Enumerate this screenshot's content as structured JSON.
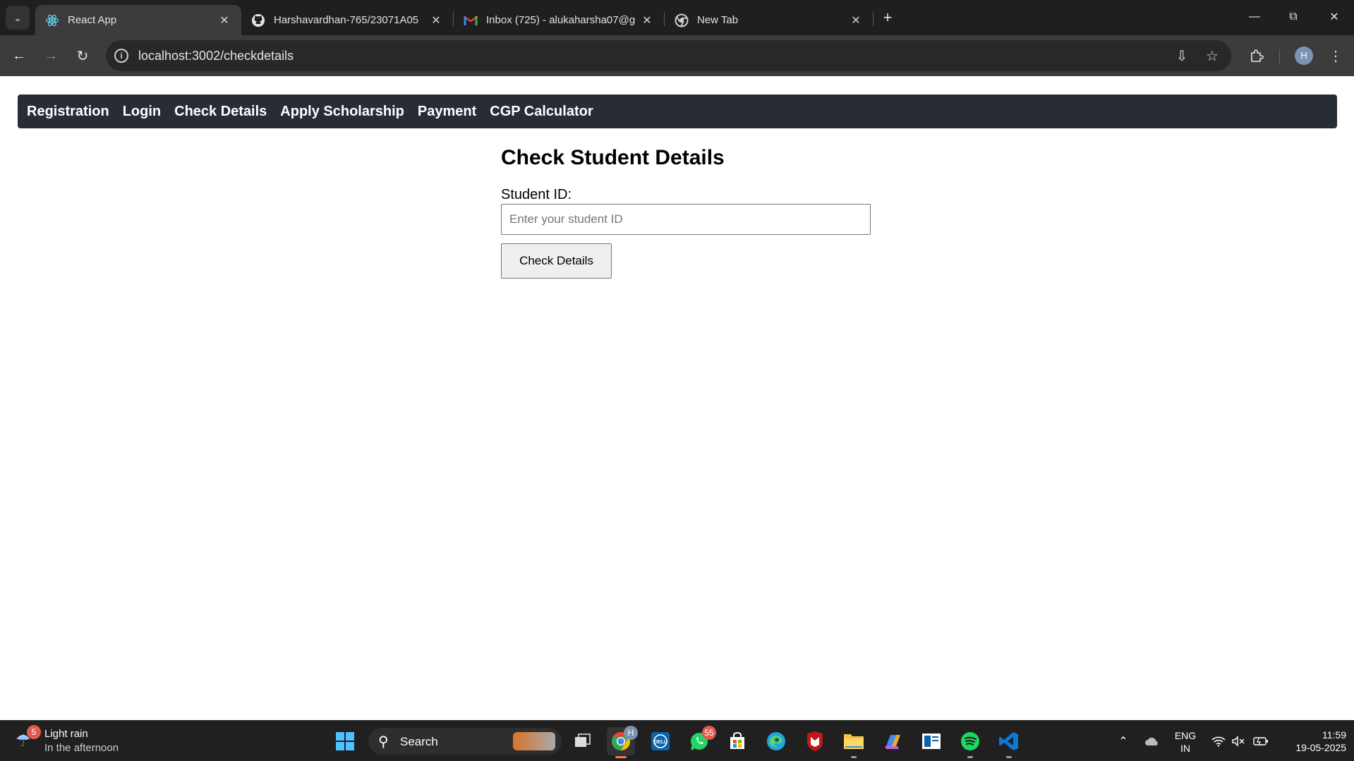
{
  "browser": {
    "tabs": [
      {
        "title": "React App",
        "active": true
      },
      {
        "title": "Harshavardhan-765/23071A05",
        "active": false
      },
      {
        "title": "Inbox (725) - alukaharsha07@g",
        "active": false
      },
      {
        "title": "New Tab",
        "active": false
      }
    ],
    "url": "localhost:3002/checkdetails"
  },
  "app": {
    "nav": [
      "Registration",
      "Login",
      "Check Details",
      "Apply Scholarship",
      "Payment",
      "CGP Calculator"
    ],
    "heading": "Check Student Details",
    "student_id_label": "Student ID:",
    "student_id_placeholder": "Enter your student ID",
    "student_id_value": "",
    "submit_label": "Check Details"
  },
  "taskbar": {
    "weather": {
      "title": "Light rain",
      "subtitle": "In the afternoon",
      "badge": "5"
    },
    "search_label": "Search",
    "profile_badge": "H",
    "whatsapp_badge": "55",
    "language": {
      "line1": "ENG",
      "line2": "IN"
    },
    "clock": {
      "time": "11:59",
      "date": "19-05-2025"
    }
  },
  "profile_initial": "H",
  "colors": {
    "app_nav_bg": "#282c34",
    "chrome_dark": "#1f1f1f",
    "chrome_toolbar": "#3c3c3c",
    "taskbar_bg": "#202020"
  }
}
